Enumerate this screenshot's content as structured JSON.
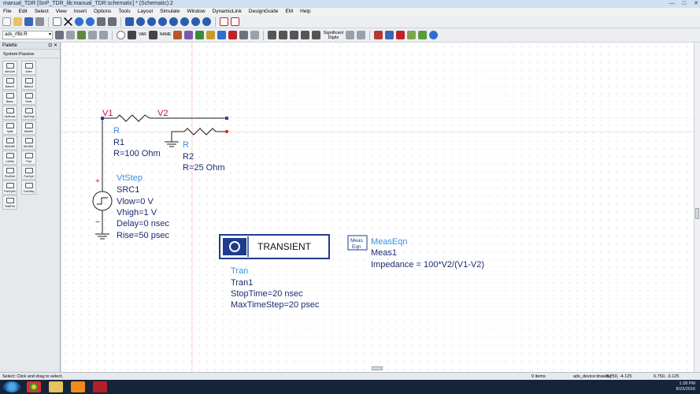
{
  "window": {
    "title": "manual_TDR [SnP_TDR_lib:manual_TDR:schematic] * (Schematic):2",
    "controls": [
      "—",
      "□",
      "✕"
    ]
  },
  "menu": [
    "File",
    "Edit",
    "Select",
    "View",
    "Insert",
    "Options",
    "Tools",
    "Layout",
    "Simulate",
    "Window",
    "DynamicLink",
    "DesignGuide",
    "EM",
    "Help"
  ],
  "toolbar": {
    "library_select": "ads_rflib:R",
    "significant_digits": "Significant Digits",
    "var_label": "VAR",
    "name_label": "NAME"
  },
  "palette": {
    "title": "Palette",
    "category": "System-Passive",
    "items": [
      "AttnUnit",
      "Atten",
      "Balun3",
      "Balun4",
      "Balun",
      "Deltx",
      "OptBuas",
      "OptSingl",
      "Splitt",
      "Wbd90",
      "Wbd180",
      "Wb180L",
      "LnkHol",
      "Pad",
      "PhsShift",
      "PwrSplt",
      "PwrSplt3",
      "TwoWay",
      "TestPort"
    ]
  },
  "schematic": {
    "nodes": [
      "V1",
      "V2"
    ],
    "R1": {
      "type": "R",
      "name": "R1",
      "param": "R=100 Ohm"
    },
    "R2": {
      "type": "R",
      "name": "R2",
      "param": "R=25 Ohm"
    },
    "source": {
      "type": "VtStep",
      "name": "SRC1",
      "params": [
        "Vlow=0 V",
        "Vhigh=1 V",
        "Delay=0 nsec",
        "Rise=50 psec"
      ],
      "plus": "+",
      "minus": "−"
    },
    "transient": {
      "label": "TRANSIENT",
      "type": "Tran",
      "name": "Tran1",
      "params": [
        "StopTime=20 nsec",
        "MaxTimeStep=20 psec"
      ]
    },
    "meas": {
      "icon_top": "Meas",
      "icon_bottom": "Eqn",
      "type": "MeasEqn",
      "name": "Meas1",
      "expr": "Impedance = 100*V2/(V1-V2)"
    }
  },
  "status": {
    "left": "Select: Click and drag to select.",
    "items": "0 items",
    "device": "ads_device:drawing",
    "coords1": "8.750, -4.125",
    "coords2": "6.750, -3.125"
  },
  "taskbar": {
    "time": "1:28 PM",
    "date": "8/23/2016"
  },
  "colors": {
    "wire": "#1e1e1e",
    "component_label": "#3a8ee0",
    "node_label": "#c0103a",
    "transient_box": "#1f3b8c"
  }
}
